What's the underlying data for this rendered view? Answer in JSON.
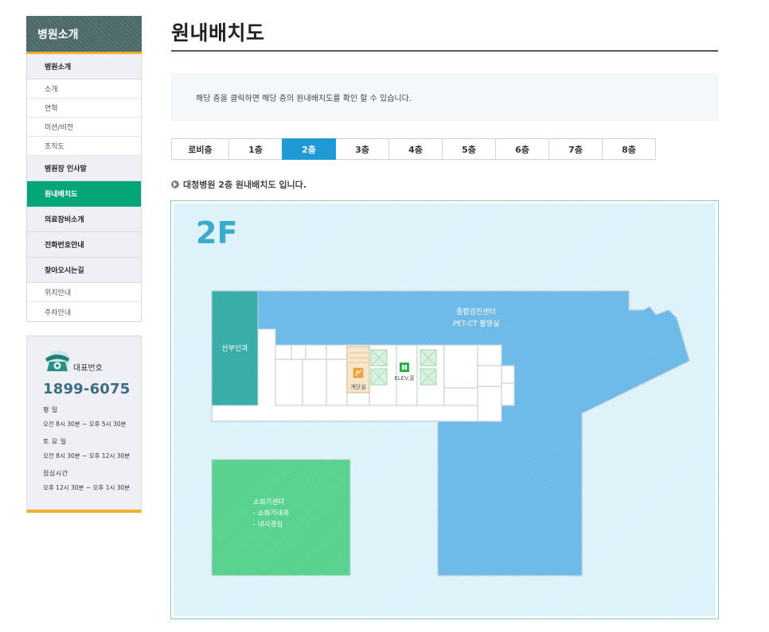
{
  "sidebar": {
    "title": "병원소개",
    "menu": [
      {
        "label": "병원소개",
        "type": "item"
      },
      {
        "label": "소개",
        "type": "sub"
      },
      {
        "label": "연혁",
        "type": "sub"
      },
      {
        "label": "미션/비전",
        "type": "sub"
      },
      {
        "label": "조직도",
        "type": "sub"
      },
      {
        "label": "병원장 인사말",
        "type": "item"
      },
      {
        "label": "원내배치도",
        "type": "item",
        "active": true
      },
      {
        "label": "의료장비소개",
        "type": "item"
      },
      {
        "label": "전화번호안내",
        "type": "item"
      },
      {
        "label": "찾아오시는길",
        "type": "item"
      },
      {
        "label": "위치안내",
        "type": "sub"
      },
      {
        "label": "주차안내",
        "type": "sub"
      }
    ]
  },
  "contact": {
    "label": "대표번호",
    "number": "1899-6075",
    "weekday_label": "평 일",
    "weekday_time": "오전 8시 30분 ~ 오후 5시 30분",
    "saturday_label": "토 요 일",
    "saturday_time": "오전 8시 30분 ~ 오후 12시 30분",
    "lunch_label": "점심시간",
    "lunch_time": "오후 12시 30분 ~ 오후 1시 30분",
    "icon": "telephone-icon"
  },
  "main": {
    "title": "원내배치도",
    "notice": "해당 층을 클릭하면 해당 층의 원내배치도를 확인 할 수 있습니다.",
    "floor_tabs": [
      "로비층",
      "1층",
      "2층",
      "3층",
      "4층",
      "5층",
      "6층",
      "7층",
      "8층"
    ],
    "active_floor": "2층",
    "caption": "대청병원 2층 원내배치도 입니다."
  },
  "map": {
    "floor_label": "2F",
    "rooms": {
      "health_center": "종합검진센터",
      "pet_ct": "PET-CT 촬영실",
      "obgyn": "산부인과",
      "stairs": "계단실",
      "elevator": "ELEV.홀",
      "gi_center": "소화기센터",
      "gi_internal": "- 소화기내과",
      "endoscopy": "- 내시경실"
    }
  },
  "colors": {
    "active_menu": "#05a57a",
    "active_tab": "#1f9ad6",
    "accent": "#f0b02c",
    "map_bg": "#dff3fb",
    "blue_zone": "#6fbbea",
    "teal_zone": "#3aaea8",
    "green_zone": "#5bd391"
  }
}
